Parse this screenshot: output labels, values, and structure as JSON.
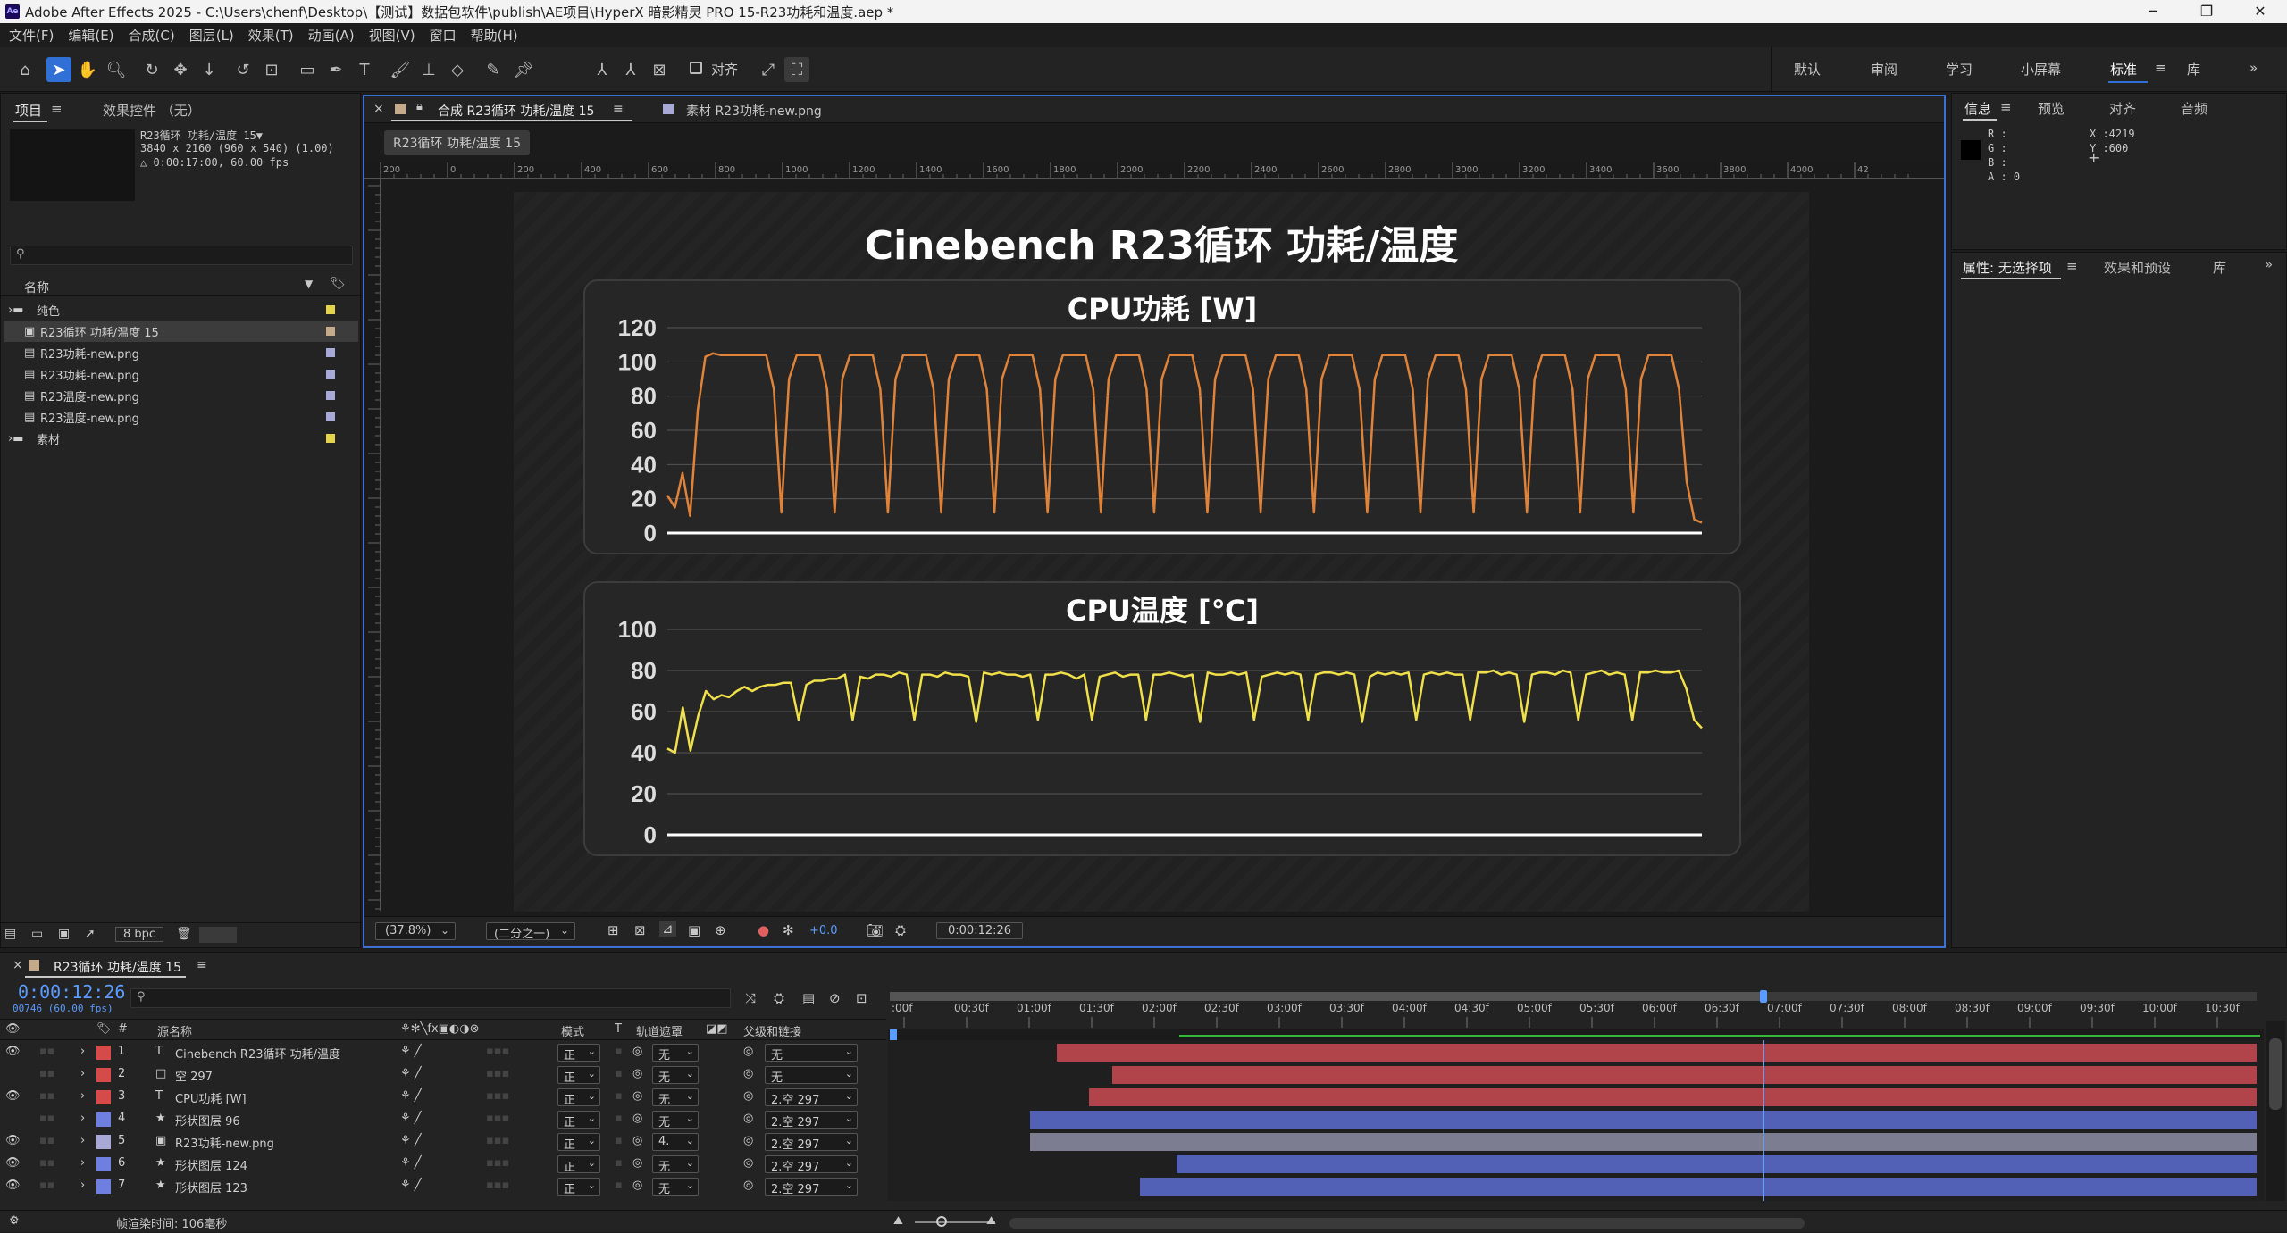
{
  "window": {
    "title": "Adobe After Effects 2025 - C:\\Users\\chenf\\Desktop\\【测试】数据包软件\\publish\\AE项目\\HyperX 暗影精灵 PRO 15-R23功耗和温度.aep *",
    "app_icon": "Ae",
    "min": "─",
    "max": "❐",
    "close": "✕"
  },
  "menu": [
    "文件(F)",
    "编辑(E)",
    "合成(C)",
    "图层(L)",
    "效果(T)",
    "动画(A)",
    "视图(V)",
    "窗口",
    "帮助(H)"
  ],
  "toolbar": {
    "snap_label": "对齐",
    "workspaces": [
      "默认",
      "审阅",
      "学习",
      "小屏幕",
      "标准",
      "库"
    ],
    "active_workspace": "标准"
  },
  "project": {
    "tab_project": "项目",
    "tab_effects": "效果控件 （无）",
    "info_name": "R23循环 功耗/温度 15▼",
    "info_size": "3840 x 2160  (960 x 540) (1.00)",
    "info_dur": "△ 0:00:17:00, 60.00 fps",
    "col_name": "名称",
    "items": [
      {
        "name": "纯色",
        "kind": "folder",
        "color": "#e3d44a"
      },
      {
        "name": "R23循环 功耗/温度 15",
        "kind": "comp",
        "color": "#c4a98a",
        "selected": true
      },
      {
        "name": "R23功耗-new.png",
        "kind": "file",
        "color": "#a9a9d8"
      },
      {
        "name": "R23功耗-new.png",
        "kind": "file",
        "color": "#a9a9d8"
      },
      {
        "name": "R23温度-new.png",
        "kind": "file",
        "color": "#a9a9d8"
      },
      {
        "name": "R23温度-new.png",
        "kind": "file",
        "color": "#a9a9d8"
      },
      {
        "name": "素材",
        "kind": "folder",
        "color": "#e3d44a"
      }
    ],
    "bpc": "8 bpc"
  },
  "viewer": {
    "tab_comp": "合成 R23循环 功耗/温度 15",
    "tab_footage": "素材 R23功耗-new.png",
    "breadcrumb": "R23循环 功耗/温度 15",
    "ruler_labels": [
      "200",
      "0",
      "200",
      "400",
      "600",
      "800",
      "1000",
      "1200",
      "1400",
      "1600",
      "1800",
      "2000",
      "2200",
      "2400",
      "2600",
      "2800",
      "3000",
      "3200",
      "3400",
      "3600",
      "3800",
      "4000",
      "42"
    ],
    "zoom": "(37.8%)",
    "resolution": "(二分之一)",
    "exposure": "+0.0",
    "timecode": "0:00:12:26"
  },
  "comp": {
    "title": "Cinebench R23循环 功耗/温度",
    "chart_data": [
      {
        "type": "line",
        "title": "CPU功耗 [W]",
        "ylim": [
          0,
          120
        ],
        "yticks": [
          "120",
          "100",
          "80",
          "60",
          "40",
          "20",
          "0"
        ],
        "color": "#e0833a",
        "values": [
          22,
          15,
          35,
          10,
          72,
          103,
          105,
          104,
          104,
          104,
          104,
          104,
          104,
          104,
          84,
          12,
          90,
          104,
          104,
          104,
          104,
          84,
          12,
          90,
          104,
          104,
          104,
          104,
          84,
          12,
          90,
          104,
          104,
          104,
          104,
          84,
          12,
          90,
          104,
          104,
          104,
          104,
          84,
          12,
          90,
          104,
          104,
          104,
          104,
          84,
          12,
          90,
          104,
          104,
          104,
          104,
          84,
          12,
          90,
          104,
          104,
          104,
          104,
          84,
          12,
          90,
          104,
          104,
          104,
          104,
          84,
          12,
          90,
          104,
          104,
          104,
          104,
          84,
          12,
          90,
          104,
          104,
          104,
          104,
          84,
          12,
          90,
          104,
          104,
          104,
          104,
          84,
          12,
          90,
          104,
          104,
          104,
          104,
          84,
          12,
          90,
          104,
          104,
          104,
          104,
          84,
          12,
          90,
          104,
          104,
          104,
          104,
          84,
          12,
          90,
          104,
          104,
          104,
          104,
          84,
          12,
          90,
          104,
          104,
          104,
          104,
          84,
          12,
          90,
          104,
          104,
          104,
          104,
          84,
          30,
          8,
          6
        ]
      },
      {
        "type": "line",
        "title": "CPU温度 [℃]",
        "ylim": [
          0,
          100
        ],
        "yticks": [
          "100",
          "80",
          "60",
          "40",
          "20",
          "0"
        ],
        "color": "#f0e04a",
        "values": [
          42,
          40,
          62,
          41,
          58,
          70,
          66,
          68,
          67,
          70,
          72,
          70,
          72,
          73,
          73,
          74,
          74,
          56,
          73,
          75,
          75,
          76,
          76,
          78,
          56,
          77,
          76,
          78,
          78,
          77,
          79,
          78,
          56,
          78,
          78,
          77,
          79,
          78,
          78,
          77,
          55,
          79,
          78,
          79,
          78,
          78,
          77,
          78,
          56,
          78,
          78,
          79,
          78,
          76,
          78,
          56,
          77,
          78,
          79,
          77,
          78,
          78,
          56,
          78,
          78,
          79,
          78,
          77,
          78,
          55,
          79,
          78,
          78,
          79,
          78,
          79,
          56,
          77,
          78,
          79,
          78,
          79,
          78,
          56,
          78,
          79,
          79,
          78,
          79,
          78,
          55,
          77,
          79,
          78,
          79,
          78,
          79,
          56,
          78,
          79,
          78,
          79,
          78,
          78,
          56,
          79,
          79,
          80,
          78,
          79,
          78,
          55,
          78,
          79,
          79,
          78,
          80,
          79,
          56,
          78,
          79,
          80,
          78,
          79,
          78,
          56,
          79,
          79,
          80,
          79,
          79,
          80,
          71,
          56,
          52
        ]
      }
    ]
  },
  "info": {
    "tab_info": "信息",
    "tab_preview": "预览",
    "tab_align": "对齐",
    "tab_audio": "音频",
    "r": "R :",
    "g": "G :",
    "b": "B :",
    "a": "A : 0",
    "x": "X :4219",
    "y": "Y :600",
    "tab_props": "属性: 无选择项",
    "tab_fx": "效果和预设",
    "tab_lib": "库"
  },
  "timeline": {
    "tab": "R23循环 功耗/温度 15",
    "timecode": "0:00:12:26",
    "frames": "00746 (60.00 fps)",
    "cols": {
      "src": "源名称",
      "mode": "模式",
      "t": "T",
      "track": "轨道遮罩",
      "parent": "父级和链接"
    },
    "ticks": [
      ":00f",
      "00:30f",
      "01:00f",
      "01:30f",
      "02:00f",
      "02:30f",
      "03:00f",
      "03:30f",
      "04:00f",
      "04:30f",
      "05:00f",
      "05:30f",
      "06:00f",
      "06:30f",
      "07:00f",
      "07:30f",
      "08:00f",
      "08:30f",
      "09:00f",
      "09:30f",
      "10:00f",
      "10:30f"
    ],
    "layers": [
      {
        "num": "1",
        "type": "T",
        "name": "Cinebench R23循环 功耗/温度",
        "label": "#d64a4a",
        "mode": "正",
        "track": "无",
        "parent": "无",
        "vis": true,
        "barStart": 0.123,
        "barColor": "#b1444a"
      },
      {
        "num": "2",
        "type": "□",
        "name": "空 297",
        "label": "#d64a4a",
        "mode": "正",
        "track": "无",
        "parent": "无",
        "vis": false,
        "barStart": 0.163,
        "barColor": "#b1444a"
      },
      {
        "num": "3",
        "type": "T",
        "name": "CPU功耗 [W]",
        "label": "#d64a4a",
        "mode": "正",
        "track": "无",
        "parent": "2.空 297",
        "vis": true,
        "barStart": 0.146,
        "barColor": "#b1444a"
      },
      {
        "num": "4",
        "type": "★",
        "name": "形状图层 96",
        "label": "#6f7fe0",
        "mode": "正",
        "track": "无",
        "parent": "2.空 297",
        "vis": false,
        "barStart": 0.103,
        "barColor": "#5260b5"
      },
      {
        "num": "5",
        "type": "▣",
        "name": "R23功耗-new.png",
        "label": "#a9a9d8",
        "mode": "正",
        "track": "4.",
        "parent": "2.空 297",
        "vis": true,
        "barStart": 0.103,
        "barColor": "#7d7d92"
      },
      {
        "num": "6",
        "type": "★",
        "name": "形状图层 124",
        "label": "#6f7fe0",
        "mode": "正",
        "track": "无",
        "parent": "2.空 297",
        "vis": true,
        "barStart": 0.21,
        "barColor": "#5260b5"
      },
      {
        "num": "7",
        "type": "★",
        "name": "形状图层 123",
        "label": "#6f7fe0",
        "mode": "正",
        "track": "无",
        "parent": "2.空 297",
        "vis": true,
        "barStart": 0.183,
        "barColor": "#5260b5"
      }
    ],
    "footer": "帧渲染时间: 106毫秒"
  }
}
